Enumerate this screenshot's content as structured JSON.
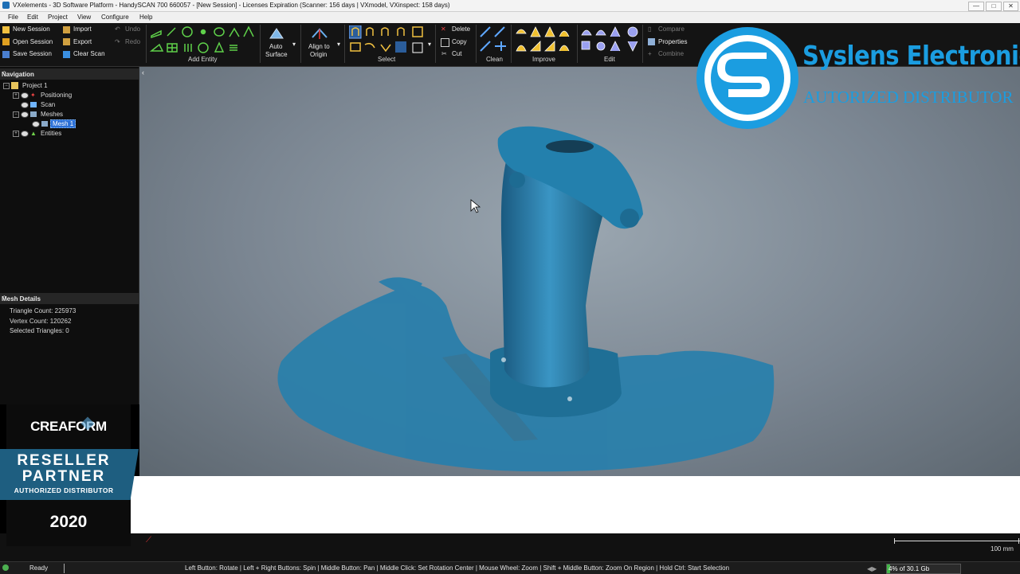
{
  "window": {
    "title": "VXelements - 3D Software Platform - HandySCAN 700 660057 - [New Session] - Licenses Expiration (Scanner: 156 days | VXmodel, VXinspect: 158 days)",
    "controls": [
      "—",
      "□",
      "✕"
    ]
  },
  "menu": [
    "File",
    "Edit",
    "Project",
    "View",
    "Configure",
    "Help"
  ],
  "ribbon": {
    "session": {
      "new": "New Session",
      "open": "Open Session",
      "save": "Save Session"
    },
    "file": {
      "import": "Import",
      "export": "Export",
      "clear_scan": "Clear Scan"
    },
    "history": {
      "undo": "Undo",
      "redo": "Redo"
    },
    "add_entity_label": "Add Entity",
    "auto_surface": {
      "line1": "Auto",
      "line2": "Surface"
    },
    "align": {
      "line1": "Align to",
      "line2": "Origin"
    },
    "select_label": "Select",
    "clipboard": {
      "delete": "Delete",
      "copy": "Copy",
      "cut": "Cut"
    },
    "clean_label": "Clean",
    "improve_label": "Improve",
    "edit_label": "Edit",
    "mesh_ops": {
      "compare": "Compare",
      "properties": "Properties",
      "combine": "Combine"
    }
  },
  "navigation": {
    "title": "Navigation",
    "tree": {
      "project": "Project 1",
      "positioning": "Positioning",
      "scan": "Scan",
      "meshes": "Meshes",
      "mesh1": "Mesh 1",
      "entities": "Entities"
    }
  },
  "mesh_details": {
    "title": "Mesh Details",
    "triangle_count": "Triangle Count: 225973",
    "vertex_count": "Vertex Count: 120262",
    "selected_triangles": "Selected Triangles: 0"
  },
  "overlay": {
    "brand_name": "Syslens Electronics",
    "brand_sub": "AUTORIZED DISTRIBUTOR",
    "creaform": "CREAFORM",
    "reseller": "RESELLER",
    "partner": "PARTNER",
    "authorized": "AUTHORIZED DISTRIBUTOR",
    "year": "2020"
  },
  "viewport": {
    "scale_label": "100 mm"
  },
  "status": {
    "ready": "Ready",
    "hints": "Left Button: Rotate | Left + Right Buttons: Spin | Middle Button: Pan | Middle Click: Set Rotation Center | Mouse Wheel: Zoom | Shift + Middle Button: Zoom On Region | Hold Ctrl: Start Selection",
    "memory": "4% of 30.1 Gb",
    "memory_fraction": 0.04
  },
  "colors": {
    "mesh": "#1f6f96",
    "mesh_highlight": "#3c93bd",
    "ribbon_bg": "#141414",
    "brand": "#1b9de0",
    "selection": "#2b6fd6"
  }
}
